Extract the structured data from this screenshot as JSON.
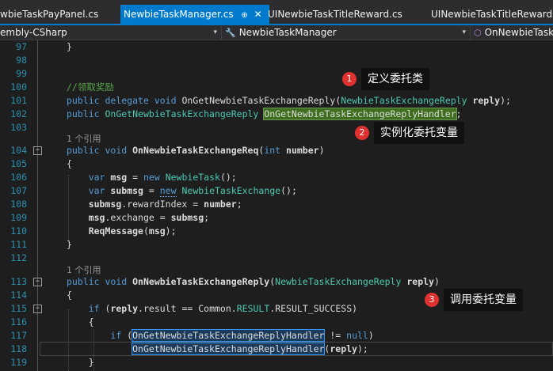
{
  "tabs": [
    {
      "label": "wbieTaskPayPanel.cs",
      "active": false
    },
    {
      "label": "NewbieTaskManager.cs",
      "active": true,
      "pin": "⊕",
      "close": "✕"
    },
    {
      "label": "UINewbieTaskTitleReward.cs",
      "active": false
    },
    {
      "label": "UINewbieTaskTitleRewards.cs",
      "active": false
    }
  ],
  "navbar": {
    "project": "embly-CSharp",
    "class": "NewbieTaskManager",
    "member": "OnNewbieTask"
  },
  "lines": [
    {
      "num": "97"
    },
    {
      "num": "98"
    },
    {
      "num": "99"
    },
    {
      "num": "100"
    },
    {
      "num": "101"
    },
    {
      "num": "102"
    },
    {
      "num": "103"
    },
    {
      "num": "104"
    },
    {
      "num": "105"
    },
    {
      "num": "106"
    },
    {
      "num": "107"
    },
    {
      "num": "108"
    },
    {
      "num": "109"
    },
    {
      "num": "110"
    },
    {
      "num": "111"
    },
    {
      "num": "112"
    },
    {
      "num": "113"
    },
    {
      "num": "114"
    },
    {
      "num": "115"
    },
    {
      "num": "116"
    },
    {
      "num": "117"
    },
    {
      "num": "118"
    },
    {
      "num": "119"
    }
  ],
  "code": {
    "l97": "}",
    "comment": "//领取奖励",
    "public": "public",
    "delegate": "delegate",
    "void": "void",
    "new": "new",
    "int": "int",
    "if": "if",
    "null": "null",
    "delegate_name": "OnGetNewbieTaskExchangeReply",
    "reply_type": "NewbieTaskExchangeReply",
    "reply_param": "reply",
    "handler": "OnGetNewbieTaskExchangeReplyHandler",
    "ref_count": "1 个引用",
    "req_method": "OnNewbieTaskExchangeReq",
    "number": "number",
    "msg": "msg",
    "submsg": "submsg",
    "newbietask": "NewbieTask",
    "newbieexchange": "NewbieTaskExchange",
    "reward_index": "rewardIndex",
    "exchange": "exchange",
    "reqmessage": "ReqMessage",
    "reply_method": "OnNewbieTaskExchangeReply",
    "result": "result",
    "common": "Common",
    "result_class": "RESULT",
    "result_success": "RESULT_SUCCESS"
  },
  "annotations": [
    {
      "num": "1",
      "text": "定义委托类"
    },
    {
      "num": "2",
      "text": "实例化委托变量"
    },
    {
      "num": "3",
      "text": "调用委托变量"
    }
  ],
  "colors": {
    "background": "#1e1e1e",
    "accent": "#007acc",
    "keyword": "#569cd6",
    "type": "#4ec9b0",
    "comment": "#57a64a",
    "linenum": "#2b91af",
    "badge": "#e03131"
  }
}
